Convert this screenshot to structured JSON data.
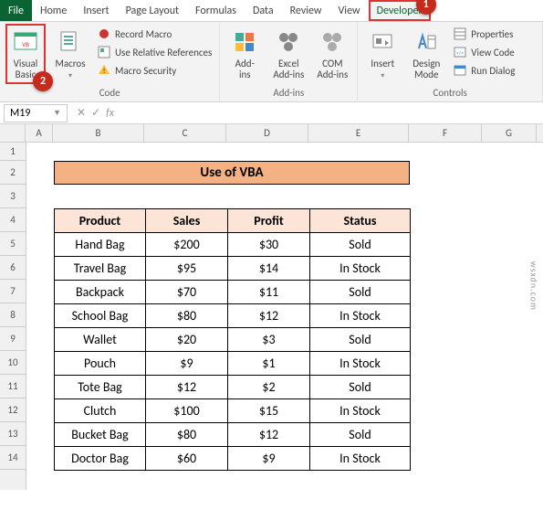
{
  "tabs": {
    "file": "File",
    "home": "Home",
    "insert": "Insert",
    "page_layout": "Page Layout",
    "formulas": "Formulas",
    "data": "Data",
    "review": "Review",
    "view": "View",
    "developer": "Developer"
  },
  "ribbon": {
    "code": {
      "label": "Code",
      "visual_basic": "Visual\nBasic",
      "macros": "Macros",
      "record_macro": "Record Macro",
      "use_relative": "Use Relative References",
      "macro_security": "Macro Security"
    },
    "addins": {
      "label": "Add-ins",
      "add_ins": "Add-\nins",
      "excel_addins": "Excel\nAdd-ins",
      "com_addins": "COM\nAdd-ins"
    },
    "controls": {
      "label": "Controls",
      "insert": "Insert",
      "design_mode": "Design\nMode",
      "properties": "Properties",
      "view_code": "View Code",
      "run_dialog": "Run Dialog"
    }
  },
  "badges": {
    "b1": "1",
    "b2": "2"
  },
  "namebox": "M19",
  "fx_label": "fx",
  "columns": [
    "A",
    "B",
    "C",
    "D",
    "E",
    "F",
    "G"
  ],
  "rows": [
    "1",
    "2",
    "3",
    "4",
    "5",
    "6",
    "7",
    "8",
    "9",
    "10",
    "11",
    "12",
    "13",
    "14"
  ],
  "title": "Use of VBA",
  "headers": {
    "product": "Product",
    "sales": "Sales",
    "profit": "Profit",
    "status": "Status"
  },
  "data": [
    {
      "product": "Hand Bag",
      "sales": "$200",
      "profit": "$30",
      "status": "Sold"
    },
    {
      "product": "Travel Bag",
      "sales": "$95",
      "profit": "$14",
      "status": "In Stock"
    },
    {
      "product": "Backpack",
      "sales": "$70",
      "profit": "$11",
      "status": "Sold"
    },
    {
      "product": "School Bag",
      "sales": "$80",
      "profit": "$12",
      "status": "In Stock"
    },
    {
      "product": "Wallet",
      "sales": "$20",
      "profit": "$3",
      "status": "Sold"
    },
    {
      "product": "Pouch",
      "sales": "$9",
      "profit": "$1",
      "status": "In Stock"
    },
    {
      "product": "Tote Bag",
      "sales": "$12",
      "profit": "$2",
      "status": "Sold"
    },
    {
      "product": "Clutch",
      "sales": "$100",
      "profit": "$15",
      "status": "In Stock"
    },
    {
      "product": "Bucket Bag",
      "sales": "$80",
      "profit": "$12",
      "status": "Sold"
    },
    {
      "product": "Doctor Bag",
      "sales": "$60",
      "profit": "$9",
      "status": "In Stock"
    }
  ],
  "watermark": "wsxdn.com"
}
